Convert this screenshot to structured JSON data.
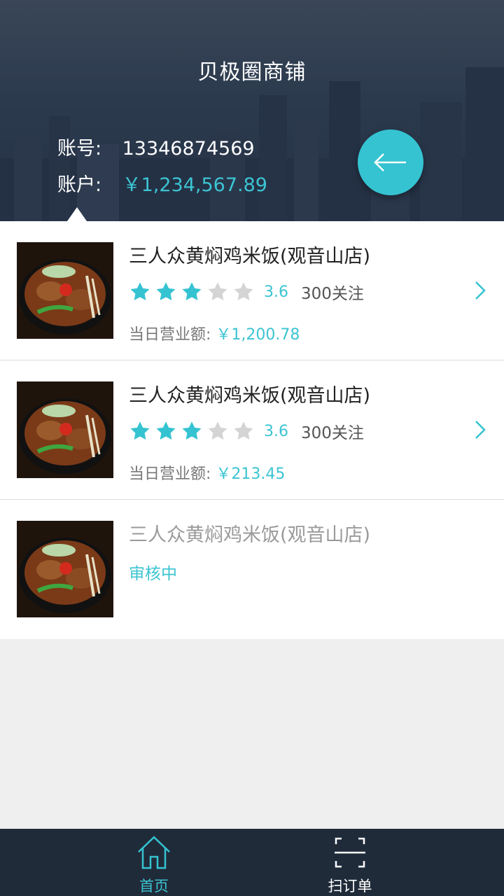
{
  "header": {
    "title": "贝极圈商铺",
    "account_label": "账号:",
    "account_value": "13346874569",
    "balance_label": "账户:",
    "balance_value": "￥1,234,567.89",
    "back_icon": "arrow-left-icon"
  },
  "shops": [
    {
      "name": "三人众黄焖鸡米饭(观音山店)",
      "rating": 3.6,
      "rating_text": "3.6",
      "stars_filled": 3,
      "stars_total": 5,
      "followers": "300关注",
      "revenue_label": "当日营业额:",
      "revenue_value": "￥1,200.78"
    },
    {
      "name": "三人众黄焖鸡米饭(观音山店)",
      "rating": 3.6,
      "rating_text": "3.6",
      "stars_filled": 3,
      "stars_total": 5,
      "followers": "300关注",
      "revenue_label": "当日营业额:",
      "revenue_value": "￥213.45"
    },
    {
      "name": "三人众黄焖鸡米饭(观音山店)",
      "status": "审核中"
    }
  ],
  "tabbar": {
    "home_label": "首页",
    "scan_label": "扫订单",
    "home_icon": "home-icon",
    "scan_icon": "scan-icon"
  },
  "colors": {
    "accent": "#35c3d1",
    "header_bg": "#2c3a4e",
    "tabbar_bg": "#202b3a",
    "star_empty": "#d4d4d4"
  }
}
